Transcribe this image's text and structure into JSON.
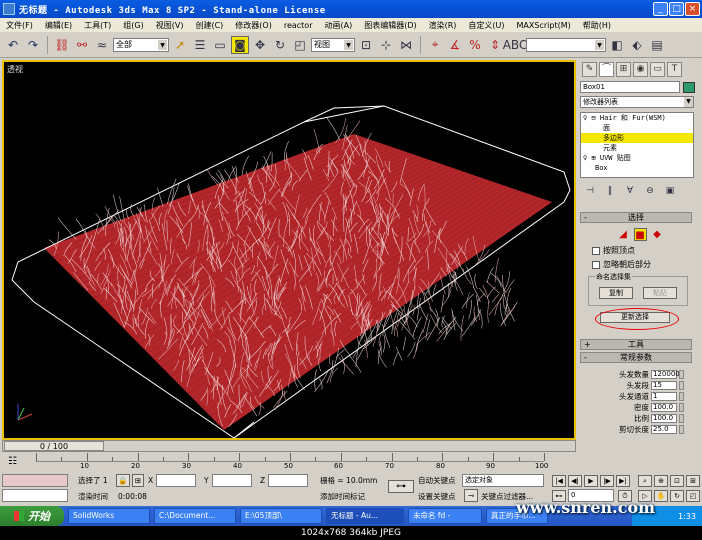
{
  "window": {
    "title": "无标题 - Autodesk 3ds Max 8 SP2  - Stand-alone License",
    "controls": [
      "_",
      "□",
      "×"
    ]
  },
  "menu": [
    "文件(F)",
    "编辑(E)",
    "工具(T)",
    "组(G)",
    "视图(V)",
    "创建(C)",
    "修改器(O)",
    "reactor",
    "动画(A)",
    "图表编辑器(D)",
    "渲染(R)",
    "自定义(U)",
    "MAXScript(M)",
    "帮助(H)"
  ],
  "toolbar": {
    "selection_filter": "全部",
    "reference_coord": "视图"
  },
  "viewport": {
    "label": "透视"
  },
  "command_panel": {
    "object_name": "Box01",
    "object_color": "#2e9a6a",
    "modifier_list": "修改器列表",
    "stack": [
      {
        "text": "♀ ⊟ Hair 和 Fur(WSM)",
        "level": 0,
        "selected": false
      },
      {
        "text": "面",
        "level": 1,
        "selected": false
      },
      {
        "text": "多边形",
        "level": 1,
        "selected": true
      },
      {
        "text": "元素",
        "level": 1,
        "selected": false
      },
      {
        "text": "♀ ⊞ UVW 贴图",
        "level": 0,
        "selected": false
      },
      {
        "text": "Box",
        "level": 0,
        "selected": false
      }
    ],
    "selection_rollout": {
      "title": "选择",
      "by_vertex": "按照顶点",
      "ignore_backfacing": "忽略朝后部分",
      "named_sets_title": "命名选择集",
      "copy": "复制",
      "paste": "粘贴",
      "update_selection": "更新选择"
    },
    "tools_rollout": "工具",
    "general_params_rollout": "常规参数",
    "params": [
      {
        "label": "头发数量",
        "value": "120000"
      },
      {
        "label": "头发段",
        "value": "15"
      },
      {
        "label": "头发通道",
        "value": "1"
      },
      {
        "label": "密度",
        "value": "100.0"
      },
      {
        "label": "比例",
        "value": "100.0"
      },
      {
        "label": "剪切长度",
        "value": "25.0"
      }
    ]
  },
  "timeline": {
    "frame_display": "0 / 100",
    "ticks": [
      "10",
      "20",
      "30",
      "40",
      "50",
      "60",
      "70",
      "80",
      "90",
      "100"
    ]
  },
  "status": {
    "selected": "选择了 1",
    "render_time_label": "渲染时间",
    "render_time": "0:00:08",
    "x_label": "X",
    "y_label": "Y",
    "z_label": "Z",
    "grid": "栅格 = 10.0mm",
    "add_time_tag": "添加时间标记",
    "auto_key": "自动关键点",
    "selected_object": "选定对象",
    "set_key": "设置关键点",
    "key_filters": "关键点过滤器...",
    "frame": "0"
  },
  "taskbar": {
    "start": "开始",
    "tasks": [
      "SolidWorks",
      "C:\\Document...",
      "E:\\05顶部\\",
      "无标题 - Au...",
      "未命名 fd -",
      "真正的手巾..."
    ],
    "clock": "1:33"
  },
  "watermark": "www.snren.com",
  "image_caption": "1024x768  364kb  JPEG"
}
